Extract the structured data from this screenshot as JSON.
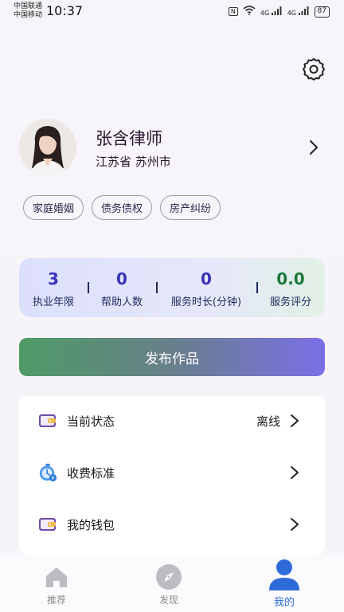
{
  "status_bar": {
    "carrier1": "中国联通",
    "carrier2": "中国移动",
    "time": "10:37",
    "nfc": "N",
    "net1": "4G",
    "net2": "4G",
    "battery": "87"
  },
  "profile": {
    "name": "张含律师",
    "location": "江苏省  苏州市"
  },
  "tags": [
    "家庭婚姻",
    "债务债权",
    "房产纠纷"
  ],
  "stats": [
    {
      "value": "3",
      "label": "执业年限",
      "color": "#3a33b8"
    },
    {
      "value": "0",
      "label": "帮助人数",
      "color": "#3a33b8"
    },
    {
      "value": "0",
      "label": "服务时长(分钟)",
      "color": "#3a33b8"
    },
    {
      "value": "0.0",
      "label": "服务评分",
      "color": "#1e7a3c"
    }
  ],
  "publish_label": "发布作品",
  "menu": [
    {
      "label": "当前状态",
      "value": "离线",
      "icon": "wallet-icon"
    },
    {
      "label": "收费标准",
      "value": "",
      "icon": "stopwatch-icon"
    },
    {
      "label": "我的钱包",
      "value": "",
      "icon": "wallet-icon"
    }
  ],
  "nav": [
    {
      "label": "推荐",
      "icon": "home-icon"
    },
    {
      "label": "发现",
      "icon": "compass-icon"
    },
    {
      "label": "我的",
      "icon": "user-icon"
    }
  ],
  "colors": {
    "accent": "#2f6bd8",
    "stat_blue": "#3a33b8",
    "stat_green": "#1e7a3c"
  }
}
